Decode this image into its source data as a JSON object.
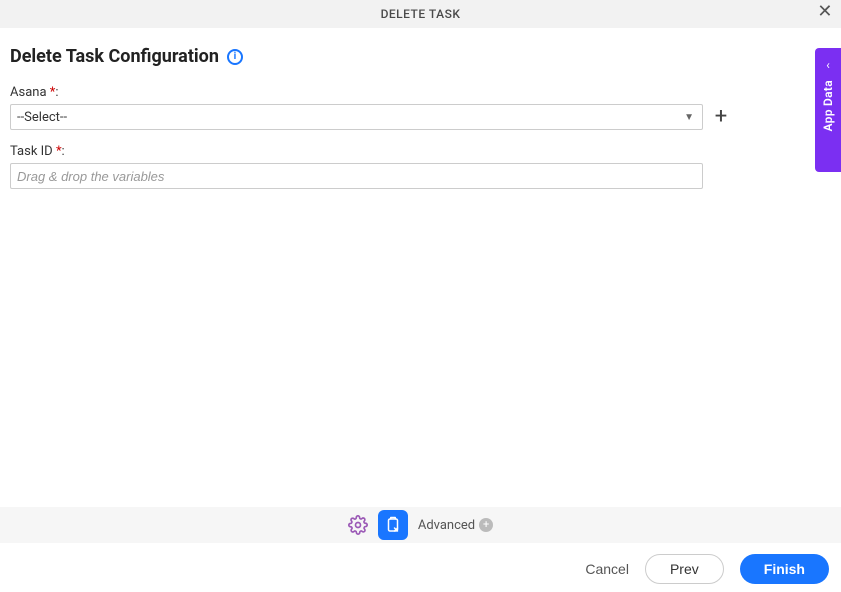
{
  "header": {
    "title": "DELETE TASK"
  },
  "page": {
    "title": "Delete Task Configuration"
  },
  "fields": {
    "asana": {
      "label": "Asana",
      "required_marker": "*",
      "selected": "--Select--"
    },
    "task_id": {
      "label": "Task ID",
      "required_marker": "*",
      "placeholder": "Drag & drop the variables",
      "value": ""
    }
  },
  "side_panel": {
    "label": "App Data"
  },
  "advanced_bar": {
    "label": "Advanced"
  },
  "footer": {
    "cancel": "Cancel",
    "prev": "Prev",
    "finish": "Finish"
  }
}
